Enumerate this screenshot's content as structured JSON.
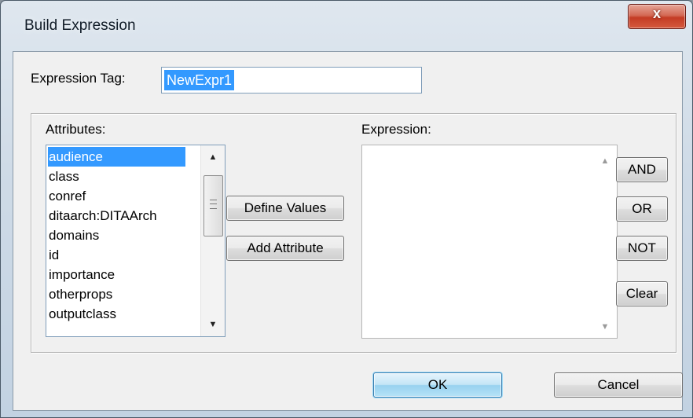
{
  "window": {
    "title": "Build Expression",
    "close_glyph": "x"
  },
  "expression_tag": {
    "label": "Expression Tag:",
    "value": "NewExpr1"
  },
  "attributes": {
    "label": "Attributes:",
    "items": [
      "audience",
      "class",
      "conref",
      "ditaarch:DITAArch",
      "domains",
      "id",
      "importance",
      "otherprops",
      "outputclass"
    ],
    "selected": "audience"
  },
  "middle_buttons": {
    "define_values": "Define Values",
    "add_attribute": "Add Attribute"
  },
  "expression": {
    "label": "Expression:",
    "value": ""
  },
  "operators": {
    "and": "AND",
    "or": "OR",
    "not": "NOT",
    "clear": "Clear"
  },
  "footer": {
    "ok": "OK",
    "cancel": "Cancel"
  },
  "icons": {
    "scroll_up": "scroll-up-arrow-icon",
    "scroll_down": "scroll-down-arrow-icon",
    "close": "close-icon"
  }
}
